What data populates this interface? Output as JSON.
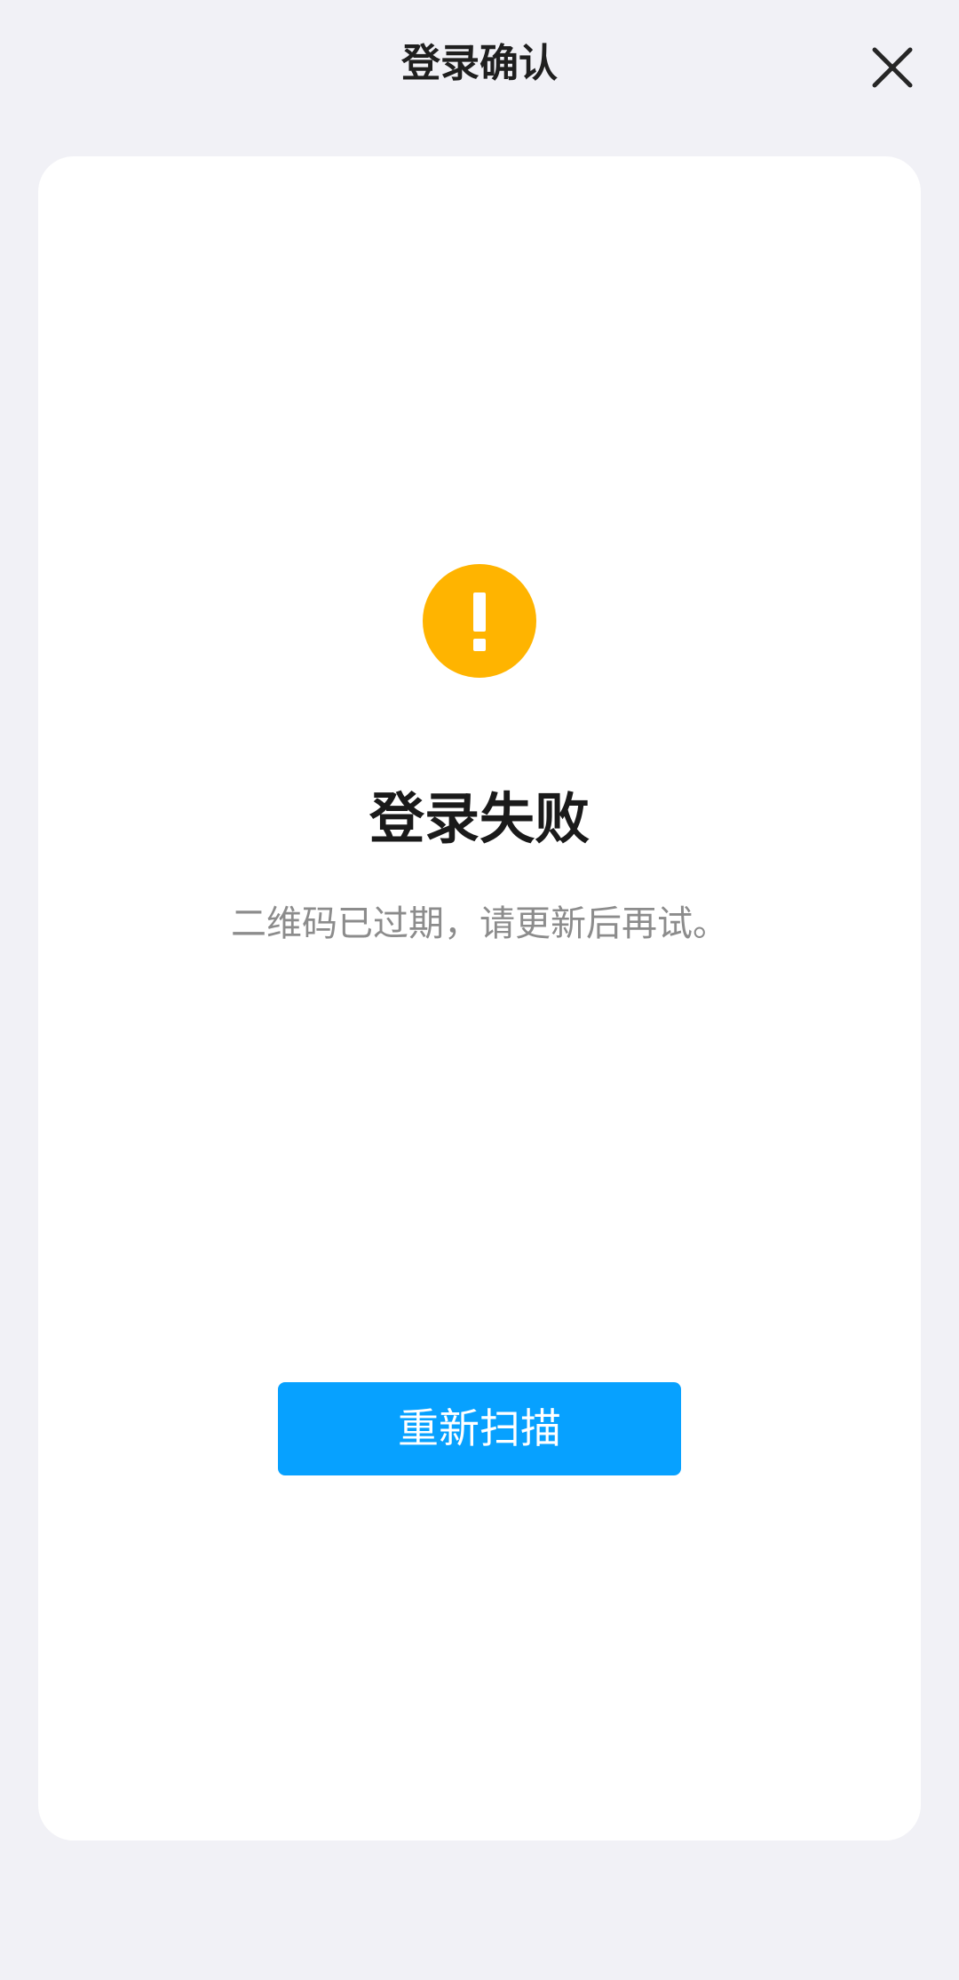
{
  "header": {
    "title": "登录确认",
    "close_icon": "close-icon"
  },
  "result": {
    "icon": "warning-icon",
    "icon_color": "#ffb400",
    "title": "登录失败",
    "description": "二维码已过期，请更新后再试。"
  },
  "actions": {
    "rescan_label": "重新扫描",
    "rescan_color": "#07a1ff"
  }
}
